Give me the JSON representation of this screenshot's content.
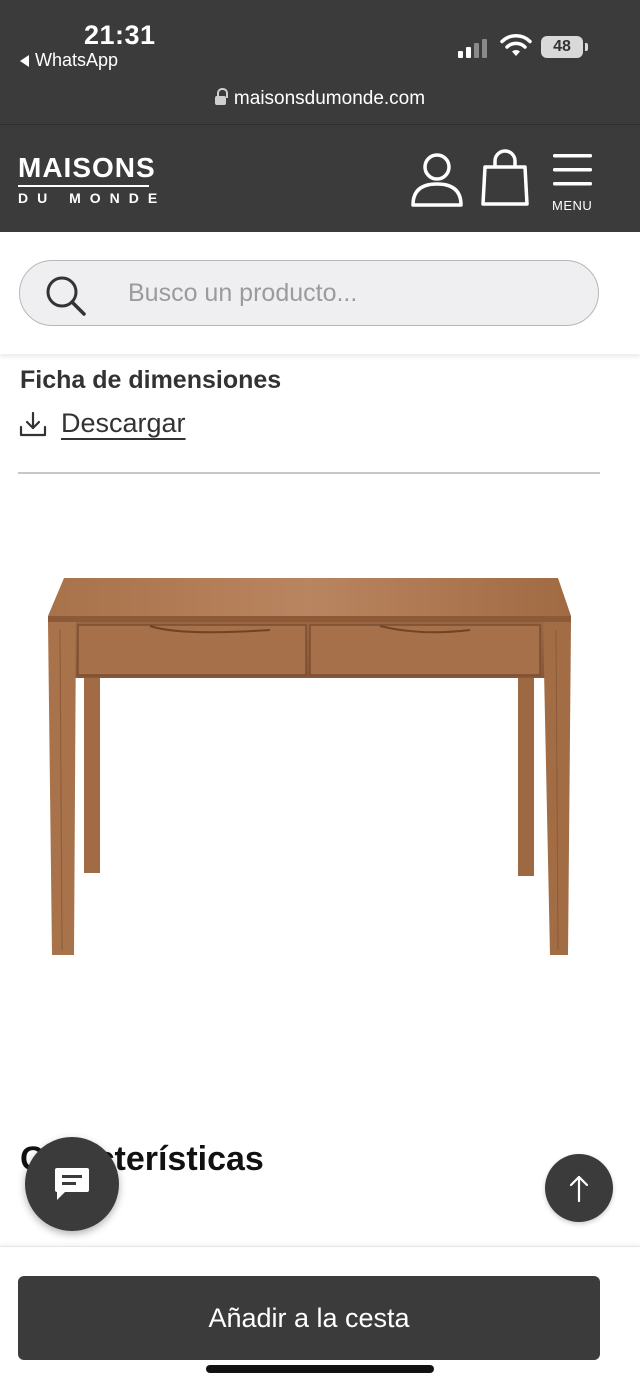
{
  "status_bar": {
    "time": "21:31",
    "back_app": "WhatsApp",
    "battery": "48"
  },
  "browser": {
    "url": "maisonsdumonde.com"
  },
  "header": {
    "logo_line1": "MAISONS",
    "logo_line2": "DU MONDE",
    "menu_label": "MENU"
  },
  "search": {
    "placeholder": "Busco un producto..."
  },
  "content": {
    "dimensions_title": "Ficha de dimensiones",
    "download_label": "Descargar",
    "features_title": "Características"
  },
  "actions": {
    "add_to_cart": "Añadir a la cesta"
  },
  "colors": {
    "header_bg": "#3b3b3b",
    "accent": "#3b3b3b"
  }
}
